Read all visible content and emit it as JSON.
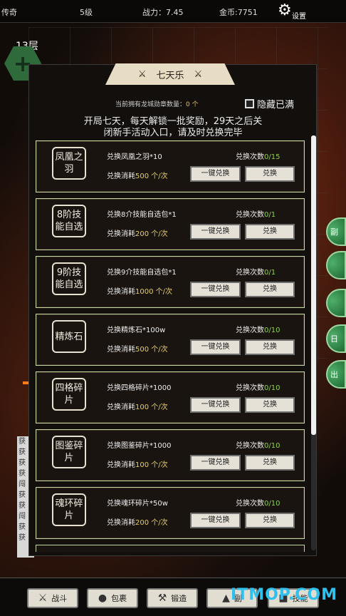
{
  "topbar": {
    "title": "传奇",
    "level": "5级",
    "power": "战力：7.45",
    "gold": "金币:7751",
    "settings_label": "设置"
  },
  "floor": "13层",
  "side_buttons": [
    "副",
    "",
    "",
    "日",
    "出"
  ],
  "log_lines": [
    "获",
    "获",
    "获",
    "获",
    "闯",
    "获",
    "获",
    "闯",
    "获",
    "获"
  ],
  "modal": {
    "title": "七天乐",
    "token_label": "当前拥有龙城勋章数量：",
    "token_value": "0 个",
    "hide_full": "隐藏已满",
    "description_line1": "开局七天，每天解锁一批奖励，29天之后关",
    "description_line2": "闭新手活动入口，请及时兑换完毕",
    "items": [
      {
        "name": "凤凰之羽",
        "exchange": "兑换凤凰之羽*10",
        "times_label": "兑换次数",
        "times": "0/15",
        "cost_label": "兑换消耗",
        "cost": "500 个/次"
      },
      {
        "name": "8阶技能自选",
        "exchange": "兑换8介技能自选包*1",
        "times_label": "兑换次数",
        "times": "0/1",
        "cost_label": "兑换消耗",
        "cost": "200 个/次"
      },
      {
        "name": "9阶技能自选",
        "exchange": "兑换9介技能自选包*1",
        "times_label": "兑换次数",
        "times": "0/1",
        "cost_label": "兑换消耗",
        "cost": "1000 个/次"
      },
      {
        "name": "精炼石",
        "exchange": "兑换精炼石*100w",
        "times_label": "兑换次数",
        "times": "0/10",
        "cost_label": "兑换消耗",
        "cost": "500 个/次"
      },
      {
        "name": "四格碎片",
        "exchange": "兑换四格碎片*1000",
        "times_label": "兑换次数",
        "times": "0/10",
        "cost_label": "兑换消耗",
        "cost": "100 个/次"
      },
      {
        "name": "图鉴碎片",
        "exchange": "兑换图鉴碎片*1000",
        "times_label": "兑换次数",
        "times": "0/10",
        "cost_label": "兑换消耗",
        "cost": "100 个/次"
      },
      {
        "name": "魂环碎片",
        "exchange": "兑换魂环碎片*50w",
        "times_label": "兑换次数",
        "times": "0/10",
        "cost_label": "兑换消耗",
        "cost": "200 个/次"
      }
    ],
    "btn_all": "一键兑换",
    "btn_one": "兑换"
  },
  "nav": {
    "battle": "战斗",
    "bag": "包裹",
    "forge": "锻造",
    "fourth": "副",
    "fifth": "技能"
  },
  "watermark": "ITMOP.COM",
  "colors": {
    "accent_green": "#8fd24e",
    "cost_yellow": "#e6cf62",
    "row_border": "#c6d6a4"
  }
}
